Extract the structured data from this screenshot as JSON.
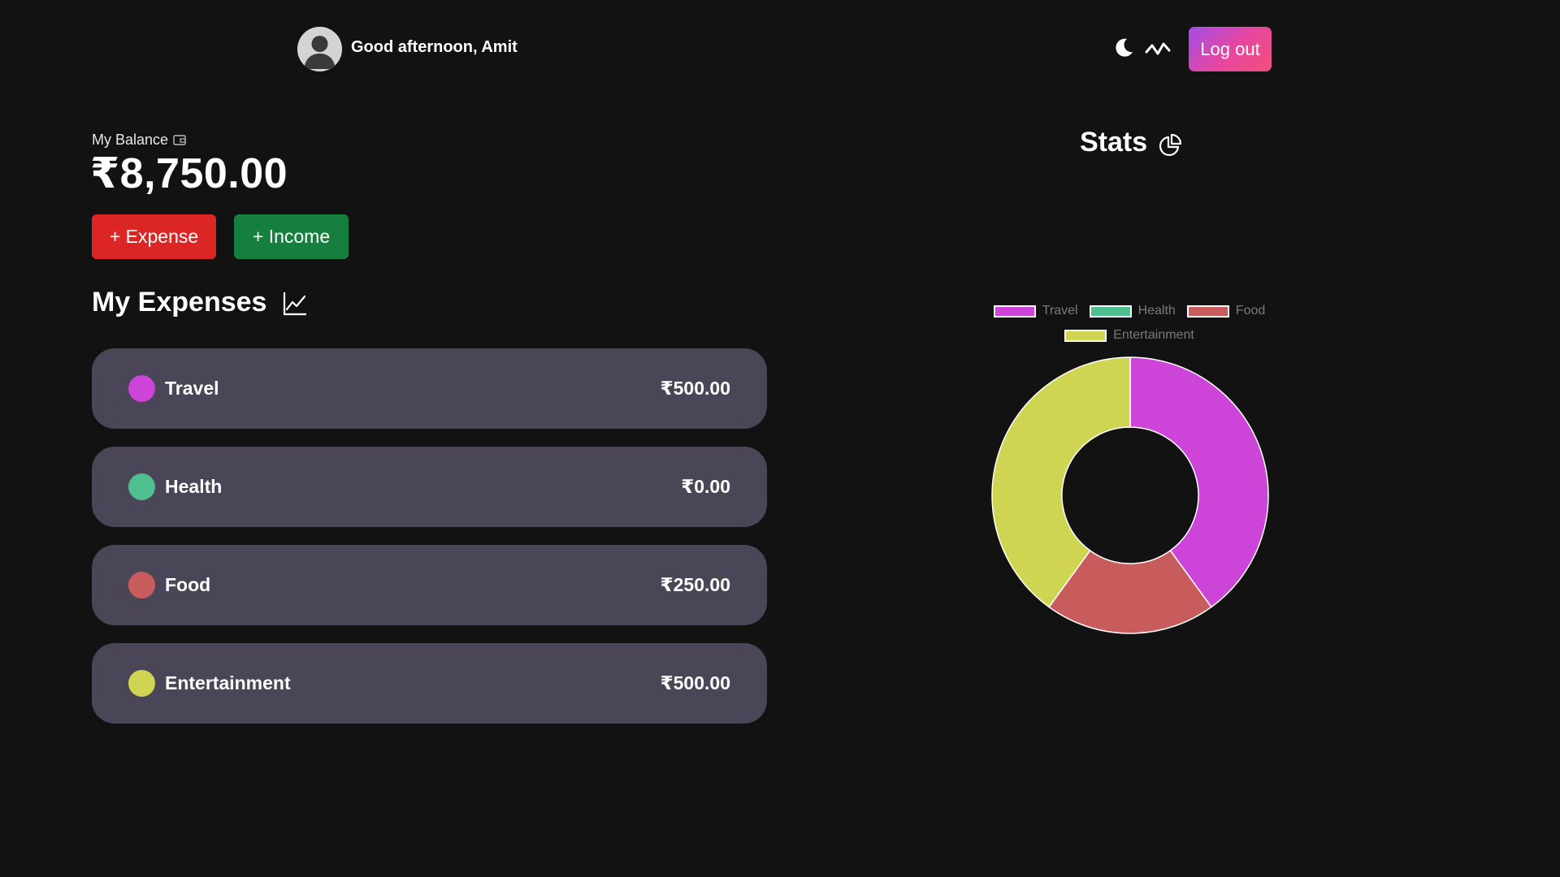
{
  "header": {
    "greeting": "Good afternoon, Amit",
    "logout_label": "Log out",
    "icons": [
      "avatar",
      "moon-icon",
      "pulse-icon"
    ]
  },
  "balance": {
    "label": "My Balance",
    "value": "₹8,750.00",
    "expense_button": "+ Expense",
    "income_button": "+ Income"
  },
  "expenses": {
    "title": "My Expenses",
    "items": [
      {
        "name": "Travel",
        "amount": "₹500.00",
        "color": "#cc44d8"
      },
      {
        "name": "Health",
        "amount": "₹0.00",
        "color": "#4fbf8f"
      },
      {
        "name": "Food",
        "amount": "₹250.00",
        "color": "#c85c5c"
      },
      {
        "name": "Entertainment",
        "amount": "₹500.00",
        "color": "#cfd452"
      }
    ]
  },
  "stats": {
    "title": "Stats"
  },
  "chart_data": {
    "type": "pie",
    "variant": "doughnut",
    "title": "",
    "categories": [
      "Travel",
      "Health",
      "Food",
      "Entertainment"
    ],
    "values": [
      500,
      0,
      250,
      500
    ],
    "colors": [
      "#cc44d8",
      "#4fbf8f",
      "#c85c5c",
      "#cfd452"
    ],
    "legend_position": "top"
  }
}
